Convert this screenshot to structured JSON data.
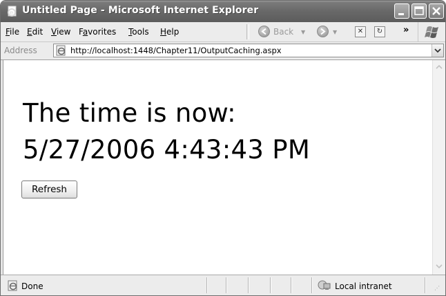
{
  "window": {
    "title": "Untitled Page - Microsoft Internet Explorer"
  },
  "menu": {
    "items": [
      {
        "pre": "",
        "key": "F",
        "post": "ile"
      },
      {
        "pre": "",
        "key": "E",
        "post": "dit"
      },
      {
        "pre": "",
        "key": "V",
        "post": "iew"
      },
      {
        "pre": "F",
        "key": "a",
        "post": "vorites"
      },
      {
        "pre": "",
        "key": "T",
        "post": "ools"
      },
      {
        "pre": "",
        "key": "H",
        "post": "elp"
      }
    ]
  },
  "toolbar": {
    "back_label": "Back",
    "more": "»"
  },
  "address": {
    "label": "Address",
    "url": "http://localhost:1448/Chapter11/OutputCaching.aspx"
  },
  "page": {
    "line1": "The time is now:",
    "line2": "5/27/2006 4:43:43 PM",
    "refresh_label": "Refresh"
  },
  "status": {
    "text": "Done",
    "zone": "Local intranet"
  }
}
